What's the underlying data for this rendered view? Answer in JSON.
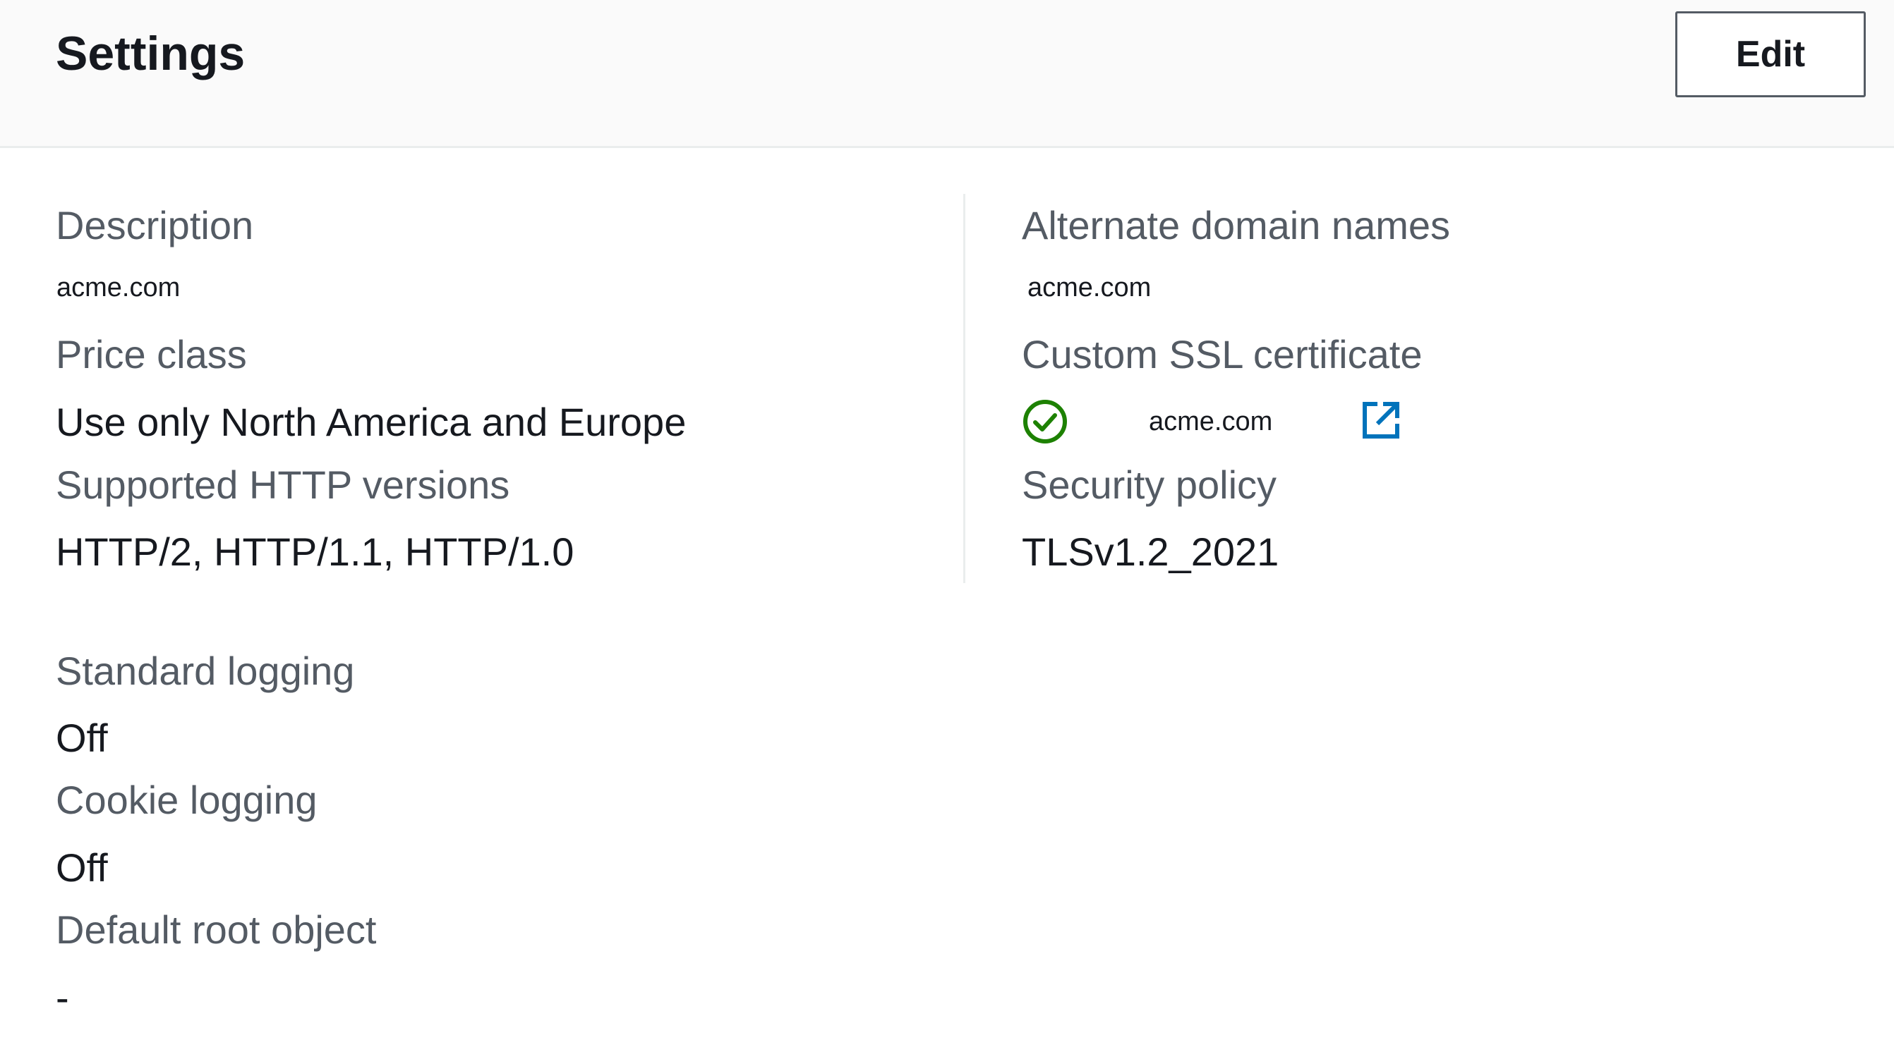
{
  "header": {
    "title": "Settings",
    "edit_label": "Edit"
  },
  "left": {
    "description": {
      "label": "Description",
      "value": "acme.com"
    },
    "price_class": {
      "label": "Price class",
      "value": "Use only North America and Europe"
    },
    "http_versions": {
      "label": "Supported HTTP versions",
      "value": "HTTP/2, HTTP/1.1, HTTP/1.0"
    },
    "standard_logging": {
      "label": "Standard logging",
      "value": "Off"
    },
    "cookie_logging": {
      "label": "Cookie logging",
      "value": "Off"
    },
    "default_root_object": {
      "label": "Default root object",
      "value": "-"
    }
  },
  "right": {
    "alternate_domains": {
      "label": "Alternate domain names",
      "value": "acme.com"
    },
    "ssl_certificate": {
      "label": "Custom SSL certificate",
      "value": "acme.com",
      "status_icon": "check-circle-icon",
      "link_icon": "external-link-icon"
    },
    "security_policy": {
      "label": "Security policy",
      "value": "TLSv1.2_2021"
    }
  },
  "colors": {
    "success": "#1d8102",
    "link": "#0073bb",
    "label": "#545b64",
    "text": "#16191f"
  }
}
